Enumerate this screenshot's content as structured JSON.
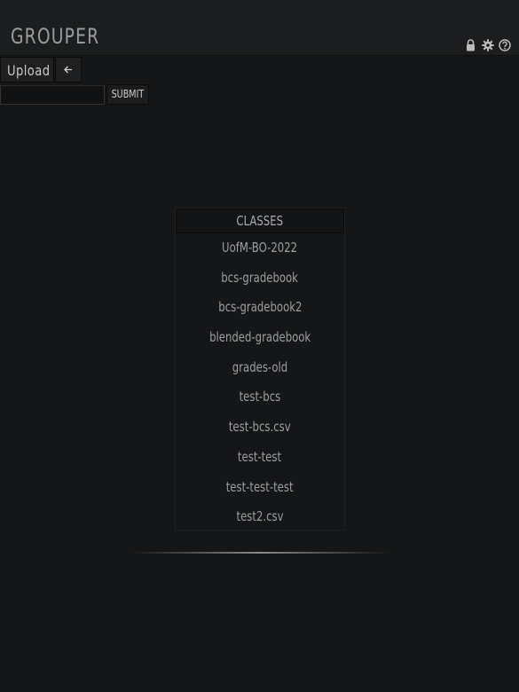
{
  "header": {
    "logo": "GROUPER",
    "icons": [
      "lock-icon",
      "gear-icon",
      "help-icon"
    ]
  },
  "toolbar": {
    "upload_label": "Upload",
    "back_icon": "arrow-left-icon"
  },
  "form": {
    "input_value": "",
    "input_placeholder": "",
    "submit_label": "SUBMIT"
  },
  "classes": {
    "title": "CLASSES",
    "items": [
      "UofM-BO-2022",
      "bcs-gradebook",
      "bcs-gradebook2",
      "blended-gradebook",
      "grades-old",
      "test-bcs",
      "test-bcs.csv",
      "test-test",
      "test-test-test",
      "test2.csv"
    ]
  },
  "colors": {
    "background": "#151617",
    "header_bg": "#1c1d1e",
    "text": "#9c9ea0",
    "divider": "#8a8a8a"
  }
}
